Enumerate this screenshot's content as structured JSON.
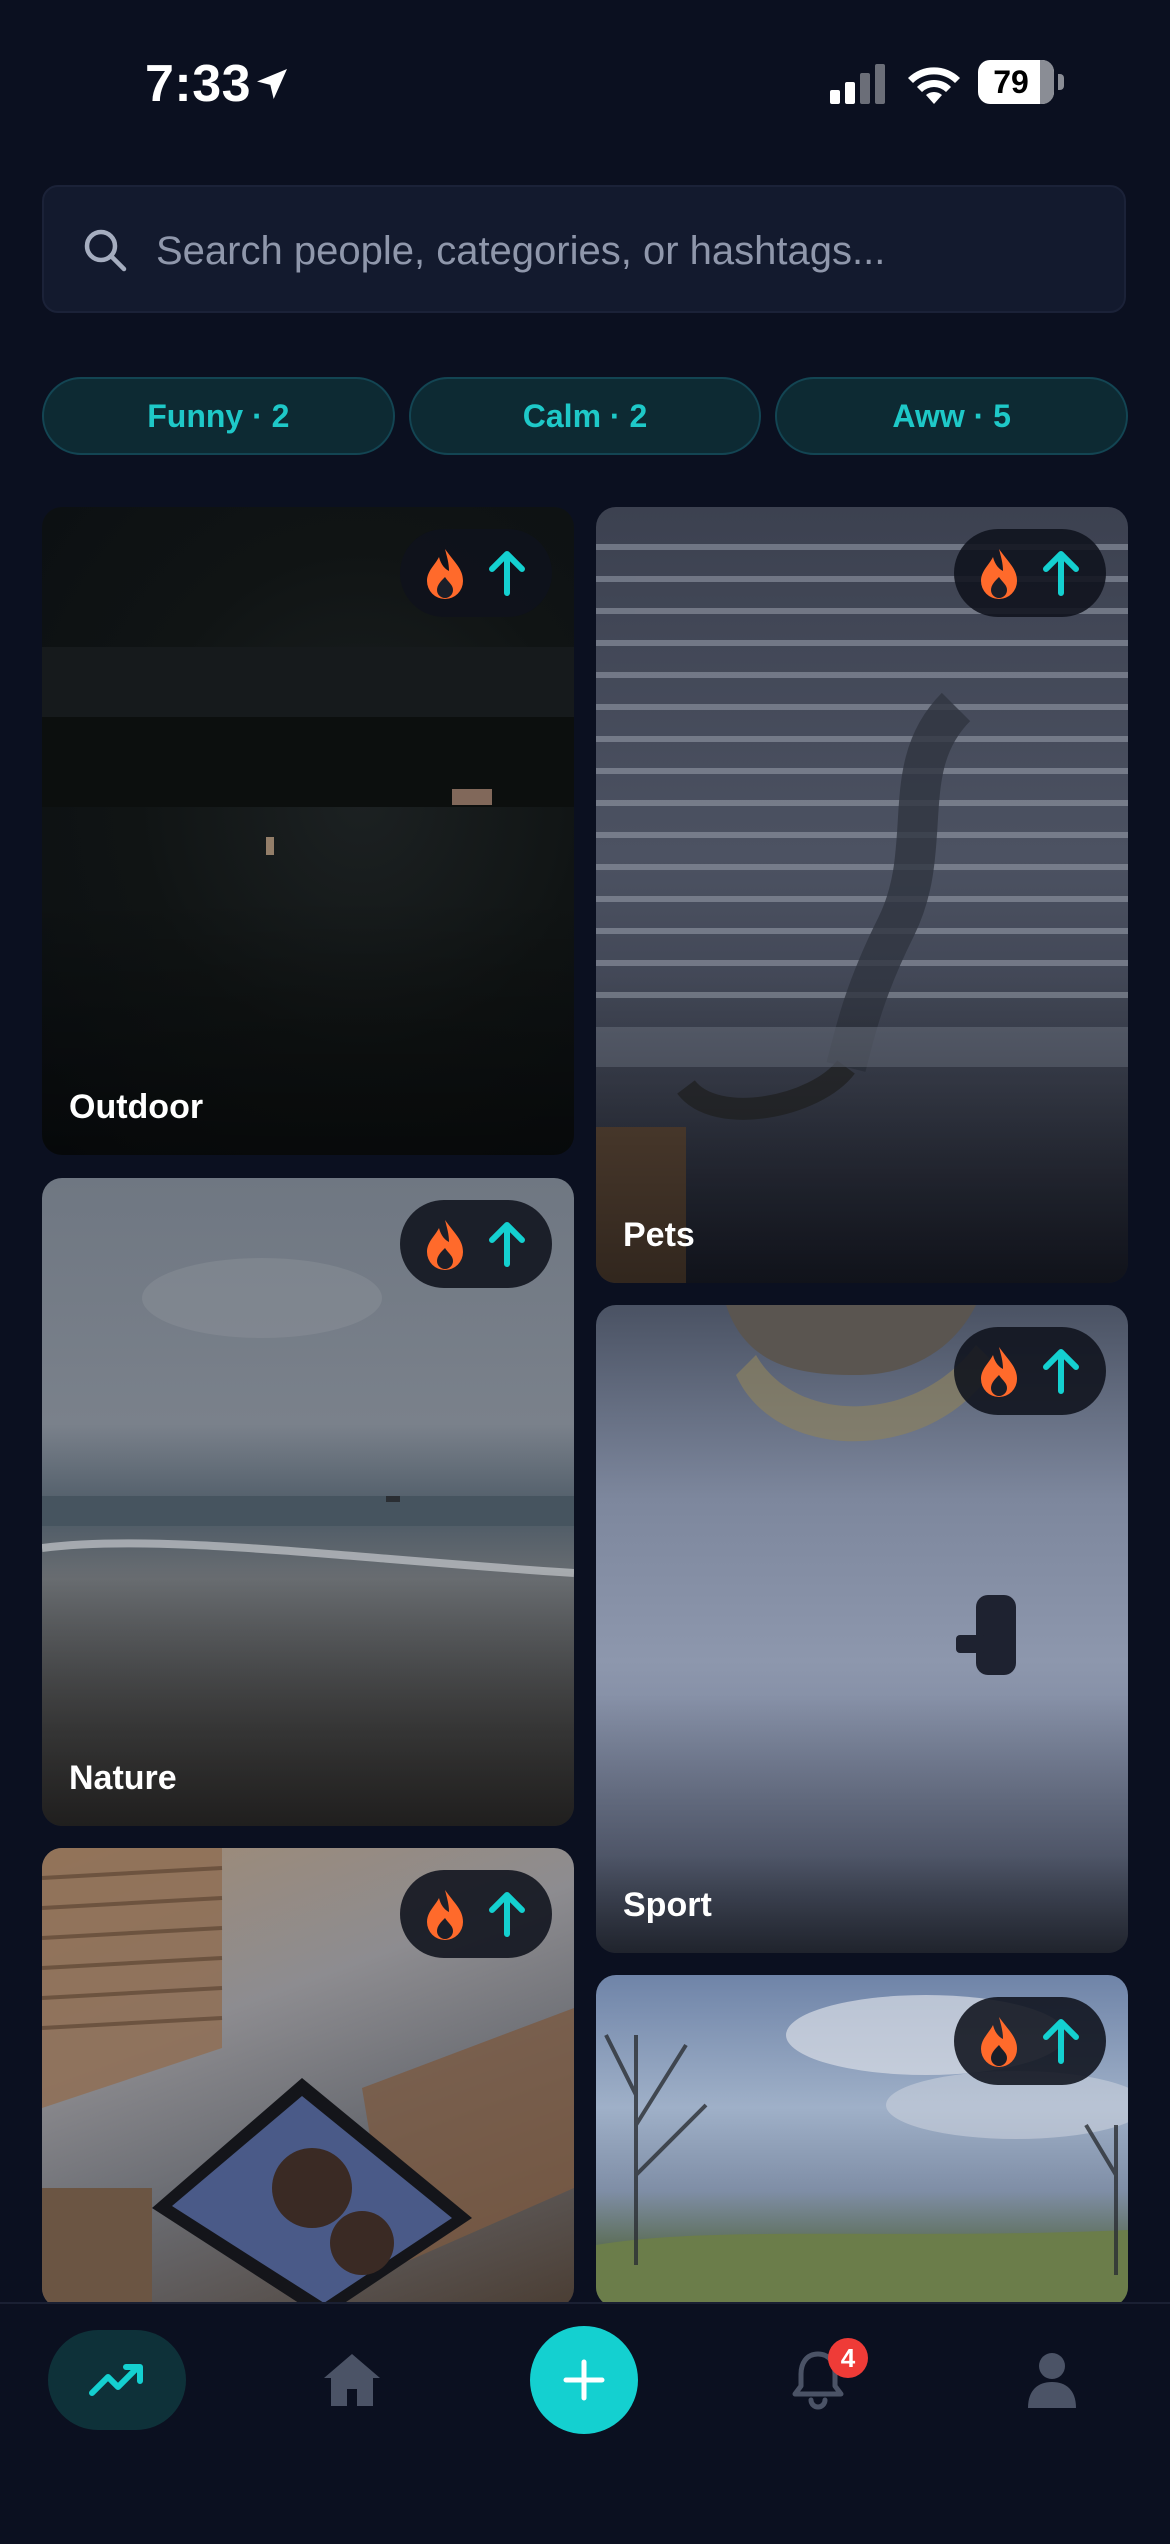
{
  "status_bar": {
    "time": "7:33",
    "battery": "79"
  },
  "search": {
    "placeholder": "Search people, categories, or hashtags..."
  },
  "chips": [
    {
      "label": "Funny · 2"
    },
    {
      "label": "Calm · 2"
    },
    {
      "label": "Aww · 5"
    }
  ],
  "feed": [
    {
      "category": "Outdoor"
    },
    {
      "category": "Pets"
    },
    {
      "category": "Nature"
    },
    {
      "category": "Sport"
    },
    {
      "category": ""
    },
    {
      "category": ""
    }
  ],
  "nav": {
    "notifications_count": "4"
  },
  "colors": {
    "accent": "#14d0d0",
    "flame": "#ff6a2b",
    "background": "#0b1020",
    "badge": "#ef3b37"
  }
}
